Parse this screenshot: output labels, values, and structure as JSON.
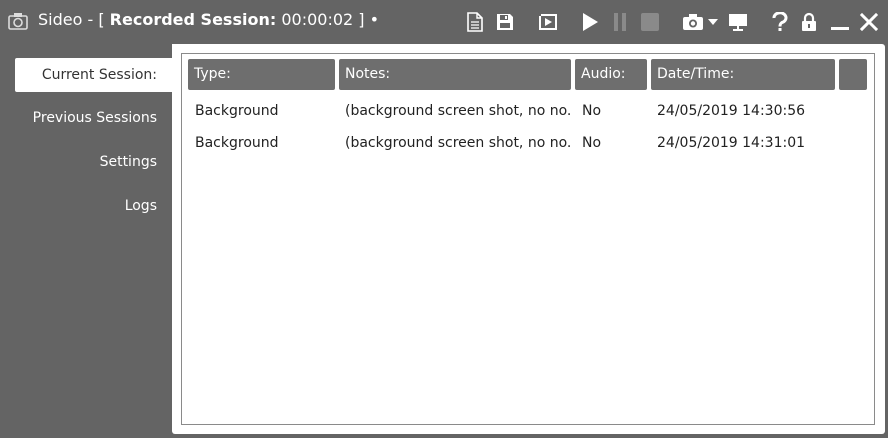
{
  "window": {
    "app_name": "Sideo - [",
    "session_label": "Recorded Session:",
    "session_time": "00:00:02",
    "title_suffix": "] •",
    "icons": [
      "camera-app-icon",
      "new-document-icon",
      "save-icon",
      "video-icon",
      "play-icon",
      "pause-icon",
      "stop-icon",
      "snapshot-camera-icon",
      "dropdown-arrow-icon",
      "monitor-icon",
      "help-icon",
      "lock-icon",
      "minimize-icon",
      "close-icon"
    ]
  },
  "sidebar": {
    "items": [
      {
        "label": "Current Session:",
        "active": true
      },
      {
        "label": "Previous Sessions",
        "active": false
      },
      {
        "label": "Settings",
        "active": false
      },
      {
        "label": "Logs",
        "active": false
      }
    ]
  },
  "table": {
    "columns": [
      "Type:",
      "Notes:",
      "Audio:",
      "Date/Time:",
      ""
    ],
    "rows": [
      {
        "type": "Background",
        "notes": "(background screen shot, no no...",
        "audio": "No",
        "datetime": "24/05/2019 14:30:56"
      },
      {
        "type": "Background",
        "notes": "(background screen shot, no no...",
        "audio": "No",
        "datetime": "24/05/2019 14:31:01"
      }
    ]
  },
  "colors": {
    "background": "#646464",
    "header": "#6e6e6e",
    "panel": "#ffffff",
    "text": "#222222"
  }
}
